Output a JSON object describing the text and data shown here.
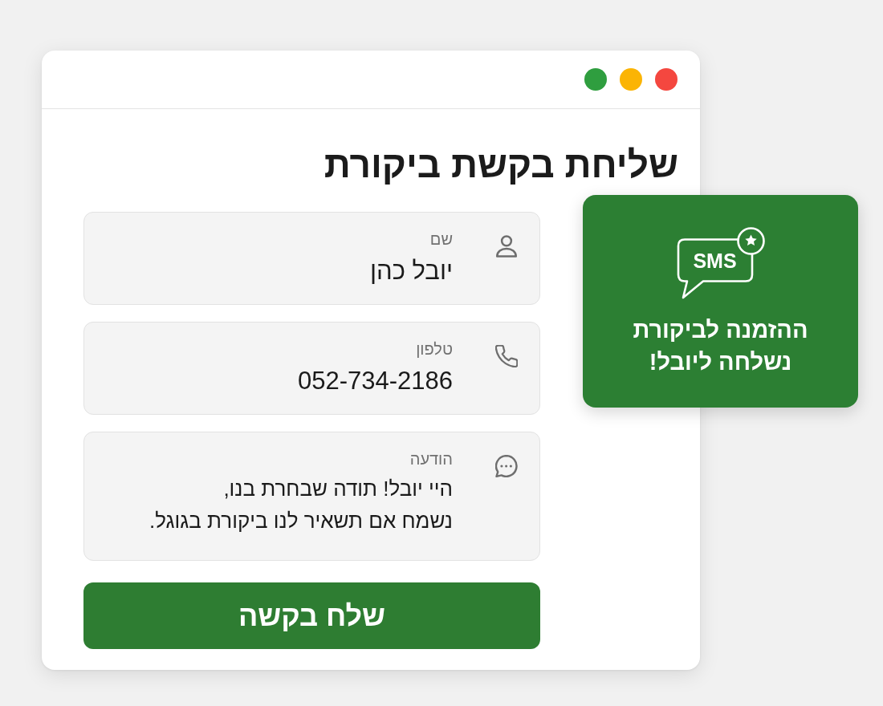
{
  "window": {
    "controls": [
      {
        "color": "#2f9e3f"
      },
      {
        "color": "#fbb404"
      },
      {
        "color": "#f4473f"
      }
    ]
  },
  "form": {
    "title": "שליחת בקשת ביקורת",
    "fields": [
      {
        "kind": "name",
        "label": "שם",
        "value": "יובל כהן"
      },
      {
        "kind": "phone",
        "label": "טלפון",
        "value": "052-734-2186"
      },
      {
        "kind": "message",
        "label": "הודעה",
        "value": "היי יובל! תודה שבחרת בנו,\nנשמח אם תשאיר לנו ביקורת בגוגל."
      }
    ],
    "submit": {
      "label": "שלח בקשה"
    }
  },
  "toast": {
    "icon_label": "SMS",
    "message": "ההזמנה לביקורת\nנשלחה ליובל!"
  }
}
